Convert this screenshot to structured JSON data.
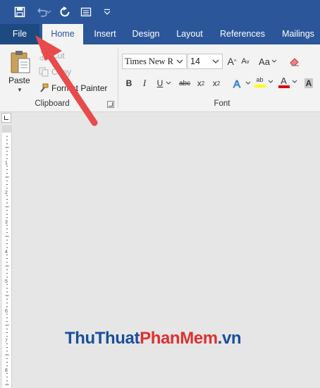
{
  "quick_access": {
    "icons": [
      "save-icon",
      "undo-icon",
      "redo-icon",
      "print-preview-icon",
      "customize-qat-icon"
    ]
  },
  "tabs": {
    "file": "File",
    "home": "Home",
    "insert": "Insert",
    "design": "Design",
    "layout": "Layout",
    "references": "References",
    "mailings": "Mailings"
  },
  "clipboard": {
    "paste": "Paste",
    "cut": "Cut",
    "copy": "Copy",
    "format_painter": "Format Painter",
    "group_label": "Clipboard"
  },
  "font": {
    "font_name": "Times New R",
    "font_size": "14",
    "group_label": "Font",
    "change_case": "Aa",
    "bold": "B",
    "italic": "I",
    "underline": "U",
    "strikethrough": "abc",
    "subscript": "x",
    "subscript_mark": "2",
    "superscript": "x",
    "superscript_mark": "2",
    "highlight": "ab",
    "font_color": "A",
    "shading": "A",
    "grow": "A",
    "shrink": "A"
  },
  "watermark": {
    "part1": "Thu",
    "part2": "Thuat",
    "part3": "Phan",
    "part4": "Mem",
    "part5": ".vn"
  },
  "colors": {
    "ribbon_blue": "#2b579a",
    "arrow_red": "#e84b4b",
    "highlight_yellow": "#ffff00",
    "font_red": "#e00000"
  }
}
